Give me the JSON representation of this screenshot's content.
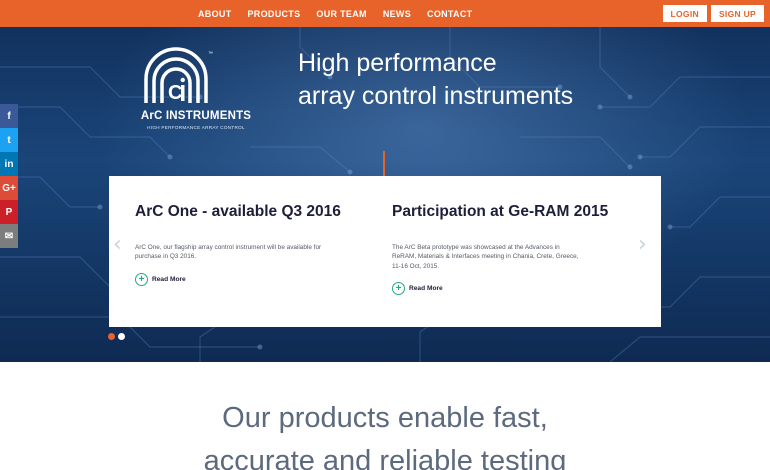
{
  "nav": {
    "items": [
      "ABOUT",
      "PRODUCTS",
      "OUR TEAM",
      "NEWS",
      "CONTACT"
    ],
    "login_label": "LOGIN",
    "signup_label": "SIGN UP"
  },
  "brand": {
    "name": "ArC INSTRUMENTS",
    "tagline": "HIGH PERFORMANCE ARRAY CONTROL",
    "trademark": "™"
  },
  "hero": {
    "headline_line1": "High performance",
    "headline_line2": "array control instruments"
  },
  "carousel": {
    "slides": [
      {
        "title": "ArC One - available Q3 2016",
        "body": "ArC One, our flagship array control instrument will be available for purchase in Q3 2016.",
        "read_more": "Read More"
      },
      {
        "title": "Participation at Ge-RAM 2015",
        "body": "The ArC Beta prototype was showcased at the Advances in ReRAM, Materials & Interfaces meeting in Chania, Crete, Greece, 11-16 Oct, 2015.",
        "read_more": "Read More"
      }
    ],
    "prev_arrow": "‹",
    "next_arrow": "›",
    "active_index": 0
  },
  "social": {
    "items": [
      {
        "icon": "facebook-icon",
        "glyph": "f",
        "color": "#3b5998"
      },
      {
        "icon": "twitter-icon",
        "glyph": "t",
        "color": "#1da1f2"
      },
      {
        "icon": "linkedin-icon",
        "glyph": "in",
        "color": "#0077b5"
      },
      {
        "icon": "googleplus-icon",
        "glyph": "G+",
        "color": "#dd4b39"
      },
      {
        "icon": "pinterest-icon",
        "glyph": "P",
        "color": "#cb2027"
      },
      {
        "icon": "email-icon",
        "glyph": "✉",
        "color": "#7d7d7d"
      }
    ]
  },
  "section": {
    "line1": "Our products enable fast,",
    "line2": "accurate and reliable testing"
  },
  "colors": {
    "accent": "#e8632a",
    "title_dark": "#1d1f3a",
    "read_more_green": "#2aa87a"
  }
}
